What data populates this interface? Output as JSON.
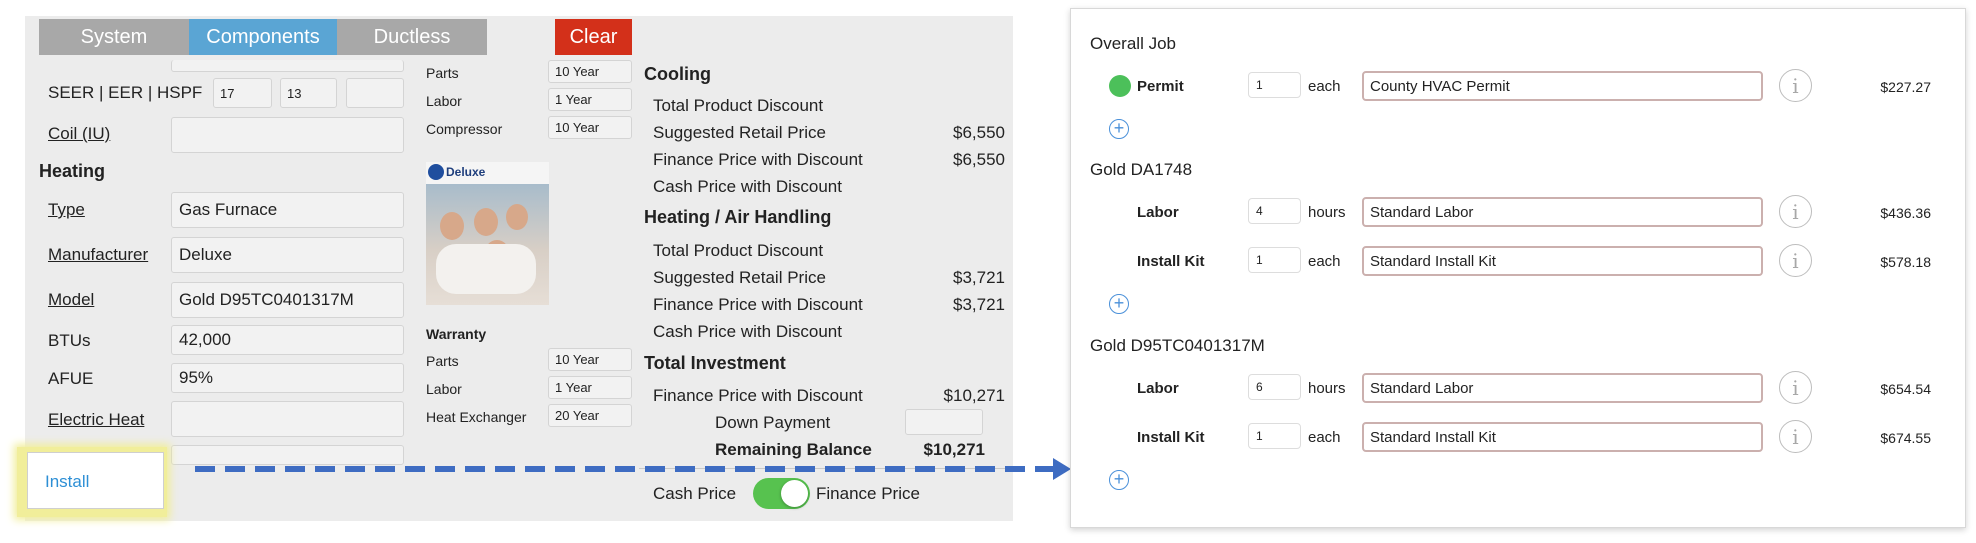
{
  "tabs": [
    {
      "label": "System"
    },
    {
      "label": "Components"
    },
    {
      "label": "Ductless"
    }
  ],
  "clear_label": "Clear",
  "efficiency": {
    "label": "SEER | EER | HSPF",
    "seer": "17",
    "eer": "13",
    "hspf": ""
  },
  "coil": {
    "label": "Coil (IU)",
    "value": ""
  },
  "heating": {
    "title": "Heating",
    "type_label": "Type",
    "type_value": "Gas Furnace",
    "manufacturer_label": "Manufacturer",
    "manufacturer_value": "Deluxe",
    "model_label": "Model",
    "model_value": "Gold D95TC0401317M",
    "btus_label": "BTUs",
    "btus_value": "42,000",
    "afue_label": "AFUE",
    "afue_value": "95%",
    "electric_heat_label": "Electric Heat",
    "electric_heat_value": ""
  },
  "cooling_warranty": [
    {
      "label": "Parts",
      "value": "10 Year"
    },
    {
      "label": "Labor",
      "value": "1 Year"
    },
    {
      "label": "Compressor",
      "value": "10 Year"
    }
  ],
  "brand_logo_text": "Deluxe",
  "warranty": {
    "title": "Warranty",
    "rows": [
      {
        "label": "Parts",
        "value": "10 Year"
      },
      {
        "label": "Labor",
        "value": "1 Year"
      },
      {
        "label": "Heat Exchanger",
        "value": "20 Year"
      }
    ]
  },
  "pricing": {
    "cooling_title": "Cooling",
    "cooling": [
      {
        "label": "Total Product Discount",
        "value": ""
      },
      {
        "label": "Suggested Retail Price",
        "value": "$6,550"
      },
      {
        "label": "Finance Price with Discount",
        "value": "$6,550"
      },
      {
        "label": "Cash Price with Discount",
        "value": ""
      }
    ],
    "heating_title": "Heating / Air Handling",
    "heating": [
      {
        "label": "Total Product Discount",
        "value": ""
      },
      {
        "label": "Suggested Retail Price",
        "value": "$3,721"
      },
      {
        "label": "Finance Price with Discount",
        "value": "$3,721"
      },
      {
        "label": "Cash Price with Discount",
        "value": ""
      }
    ],
    "total_title": "Total Investment",
    "total_finance_label": "Finance Price with Discount",
    "total_finance_value": "$10,271",
    "down_payment_label": "Down Payment",
    "down_payment_value": "",
    "remaining_label": "Remaining Balance",
    "remaining_value": "$10,271"
  },
  "toggle": {
    "left_label": "Cash Price",
    "right_label": "Finance Price",
    "on": true
  },
  "install_label": "Install",
  "colors": {
    "accent": "#5aa5d4",
    "clear": "#d3301a",
    "toggle_on": "#57c24f",
    "highlight": "#f1ee9a",
    "arrow": "#3e6cc2",
    "permit_status": "#4cc05a"
  },
  "install_panel": {
    "groups": [
      {
        "title": "Overall Job",
        "items": [
          {
            "label": "Permit",
            "qty": "1",
            "unit": "each",
            "description": "County HVAC Permit",
            "price": "$227.27"
          }
        ]
      },
      {
        "title": "Gold DA1748",
        "items": [
          {
            "label": "Labor",
            "qty": "4",
            "unit": "hours",
            "description": "Standard Labor",
            "price": "$436.36"
          },
          {
            "label": "Install Kit",
            "qty": "1",
            "unit": "each",
            "description": "Standard Install Kit",
            "price": "$578.18"
          }
        ]
      },
      {
        "title": "Gold D95TC0401317M",
        "items": [
          {
            "label": "Labor",
            "qty": "6",
            "unit": "hours",
            "description": "Standard Labor",
            "price": "$654.54"
          },
          {
            "label": "Install Kit",
            "qty": "1",
            "unit": "each",
            "description": "Standard Install Kit",
            "price": "$674.55"
          }
        ]
      }
    ]
  }
}
